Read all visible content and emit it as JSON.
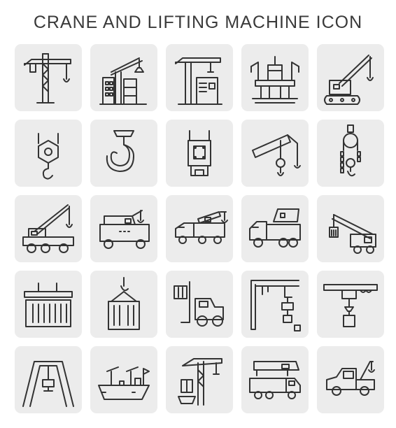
{
  "title": "CRANE AND LIFTING MACHINE ICON",
  "icons": [
    [
      "tower-crane",
      "construction-crane",
      "port-crane",
      "offshore-platform",
      "crawler-crane"
    ],
    [
      "crane-hook-block",
      "crane-hook",
      "hook-block",
      "crane-boom-hook",
      "chain-hoist"
    ],
    [
      "mobile-crane",
      "crane-truck",
      "truck-crane",
      "dump-truck",
      "truck-crane-container"
    ],
    [
      "container-spreader",
      "hook-lifting-container",
      "forklift",
      "overhead-crane-warehouse",
      "overhead-bridge-crane"
    ],
    [
      "gantry-crane",
      "cargo-ship-cranes",
      "port-tower-crane",
      "mobile-crane-truck",
      "tow-truck"
    ]
  ]
}
